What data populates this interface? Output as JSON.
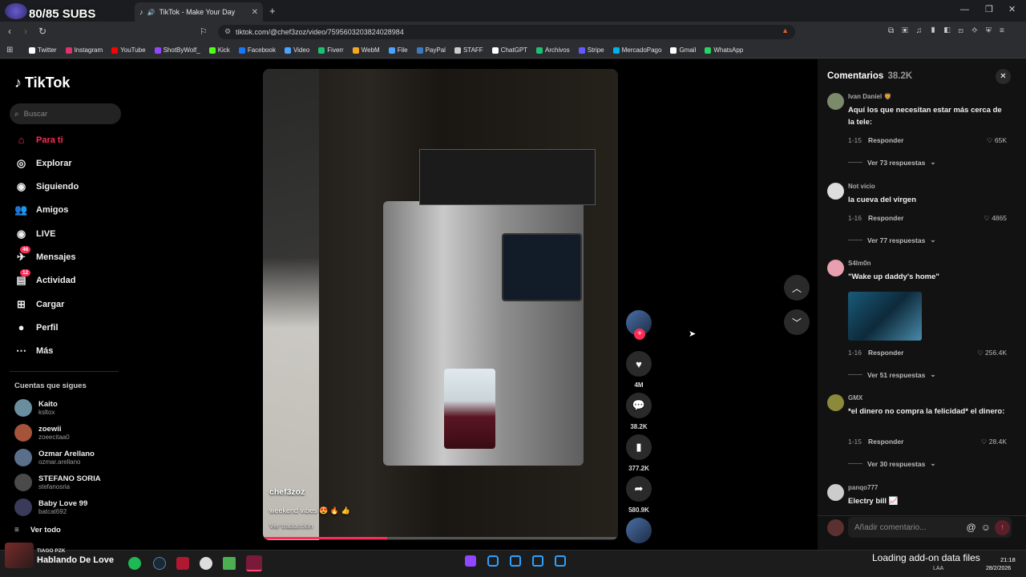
{
  "overlay": {
    "subs": "80/85 SUBS"
  },
  "browser": {
    "tab_title": "TikTok - Make Your Day",
    "new_tab": "+",
    "url": "tiktok.com/@chef3zoz/video/7595603203824028984",
    "bookmarks": [
      {
        "label": "Twitter",
        "color": "#ffffff"
      },
      {
        "label": "Instagram",
        "color": "#e1306c"
      },
      {
        "label": "YouTube",
        "color": "#ff0000"
      },
      {
        "label": "ShotByWolf_",
        "color": "#9146ff"
      },
      {
        "label": "Kick",
        "color": "#53fc18"
      },
      {
        "label": "Facebook",
        "color": "#1877f2"
      },
      {
        "label": "Video",
        "color": "#4aa3ff"
      },
      {
        "label": "Fiverr",
        "color": "#1dbf73"
      },
      {
        "label": "WebM",
        "color": "#f5a623"
      },
      {
        "label": "File",
        "color": "#4aa3ff"
      },
      {
        "label": "PayPal",
        "color": "#3b7bbf"
      },
      {
        "label": "STAFF",
        "color": "#cccccc"
      },
      {
        "label": "ChatGPT",
        "color": "#ffffff"
      },
      {
        "label": "Archivos",
        "color": "#1dbf73"
      },
      {
        "label": "Stripe",
        "color": "#635bff"
      },
      {
        "label": "MercadoPago",
        "color": "#00b1ea"
      },
      {
        "label": "Gmail",
        "color": "#ffffff"
      },
      {
        "label": "WhatsApp",
        "color": "#25d366"
      }
    ]
  },
  "tiktok": {
    "logo": "TikTok",
    "search_placeholder": "Buscar",
    "nav": [
      {
        "label": "Para ti",
        "icon": "home-icon",
        "active": true
      },
      {
        "label": "Explorar",
        "icon": "compass-icon"
      },
      {
        "label": "Siguiendo",
        "icon": "following-icon"
      },
      {
        "label": "Amigos",
        "icon": "friends-icon"
      },
      {
        "label": "LIVE",
        "icon": "live-icon"
      },
      {
        "label": "Mensajes",
        "icon": "messages-icon",
        "badge": "46"
      },
      {
        "label": "Actividad",
        "icon": "activity-icon",
        "badge": "12"
      },
      {
        "label": "Cargar",
        "icon": "upload-icon"
      },
      {
        "label": "Perfil",
        "icon": "profile-icon"
      },
      {
        "label": "Más",
        "icon": "more-icon"
      }
    ],
    "following_title": "Cuentas que sigues",
    "following": [
      {
        "name": "Kaito",
        "user": "ksltox"
      },
      {
        "name": "zoewii",
        "user": "zoeecitaa0"
      },
      {
        "name": "Ozmar Arellano",
        "user": "ozmar.arellano"
      },
      {
        "name": "STEFANO SORIA",
        "user": "stefanosria"
      },
      {
        "name": "Baby Love 99",
        "user": "batcat692"
      }
    ],
    "see_all": "Ver todo"
  },
  "video": {
    "author": "chef3zoz",
    "caption": "weekend vibes 😍 🔥 👍",
    "translate": "Ver traducción",
    "progress": 0.35,
    "actions": {
      "likes": "4M",
      "comments": "38.2K",
      "saves": "377.2K",
      "shares": "580.9K"
    }
  },
  "comments": {
    "title": "Comentarios",
    "count": "38.2K",
    "reply_label": "Responder",
    "items": [
      {
        "user": "Ivan Daniel 🦁",
        "text": "Aquí los que necesitan estar más cerca de la tele:",
        "date": "1-15",
        "likes": "65K",
        "replies": "Ver 73 respuestas"
      },
      {
        "user": "Not vicio",
        "text": "la cueva del virgen",
        "date": "1-16",
        "likes": "4865",
        "replies": "Ver 77 respuestas"
      },
      {
        "user": "S4lm0n",
        "text": "\"Wake up daddy's home\"",
        "date": "1-16",
        "likes": "256.4K",
        "replies": "Ver 51 respuestas"
      },
      {
        "user": "GMX",
        "text": "*el dinero no compra la felicidad* el dinero:",
        "date": "1-15",
        "likes": "28.4K",
        "replies": "Ver 30 respuestas"
      },
      {
        "user": "panqo777",
        "text": "Electry bill 📈"
      }
    ],
    "input_placeholder": "Añadir comentario...",
    "at_symbol": "@"
  },
  "taskbar": {
    "now_playing_artist": "TIAGO PZK",
    "now_playing_title": "Hablando De Love",
    "notice": "Loading add-on data files",
    "lang": "LAA",
    "time": "21:18",
    "date": "28/2/2026"
  }
}
